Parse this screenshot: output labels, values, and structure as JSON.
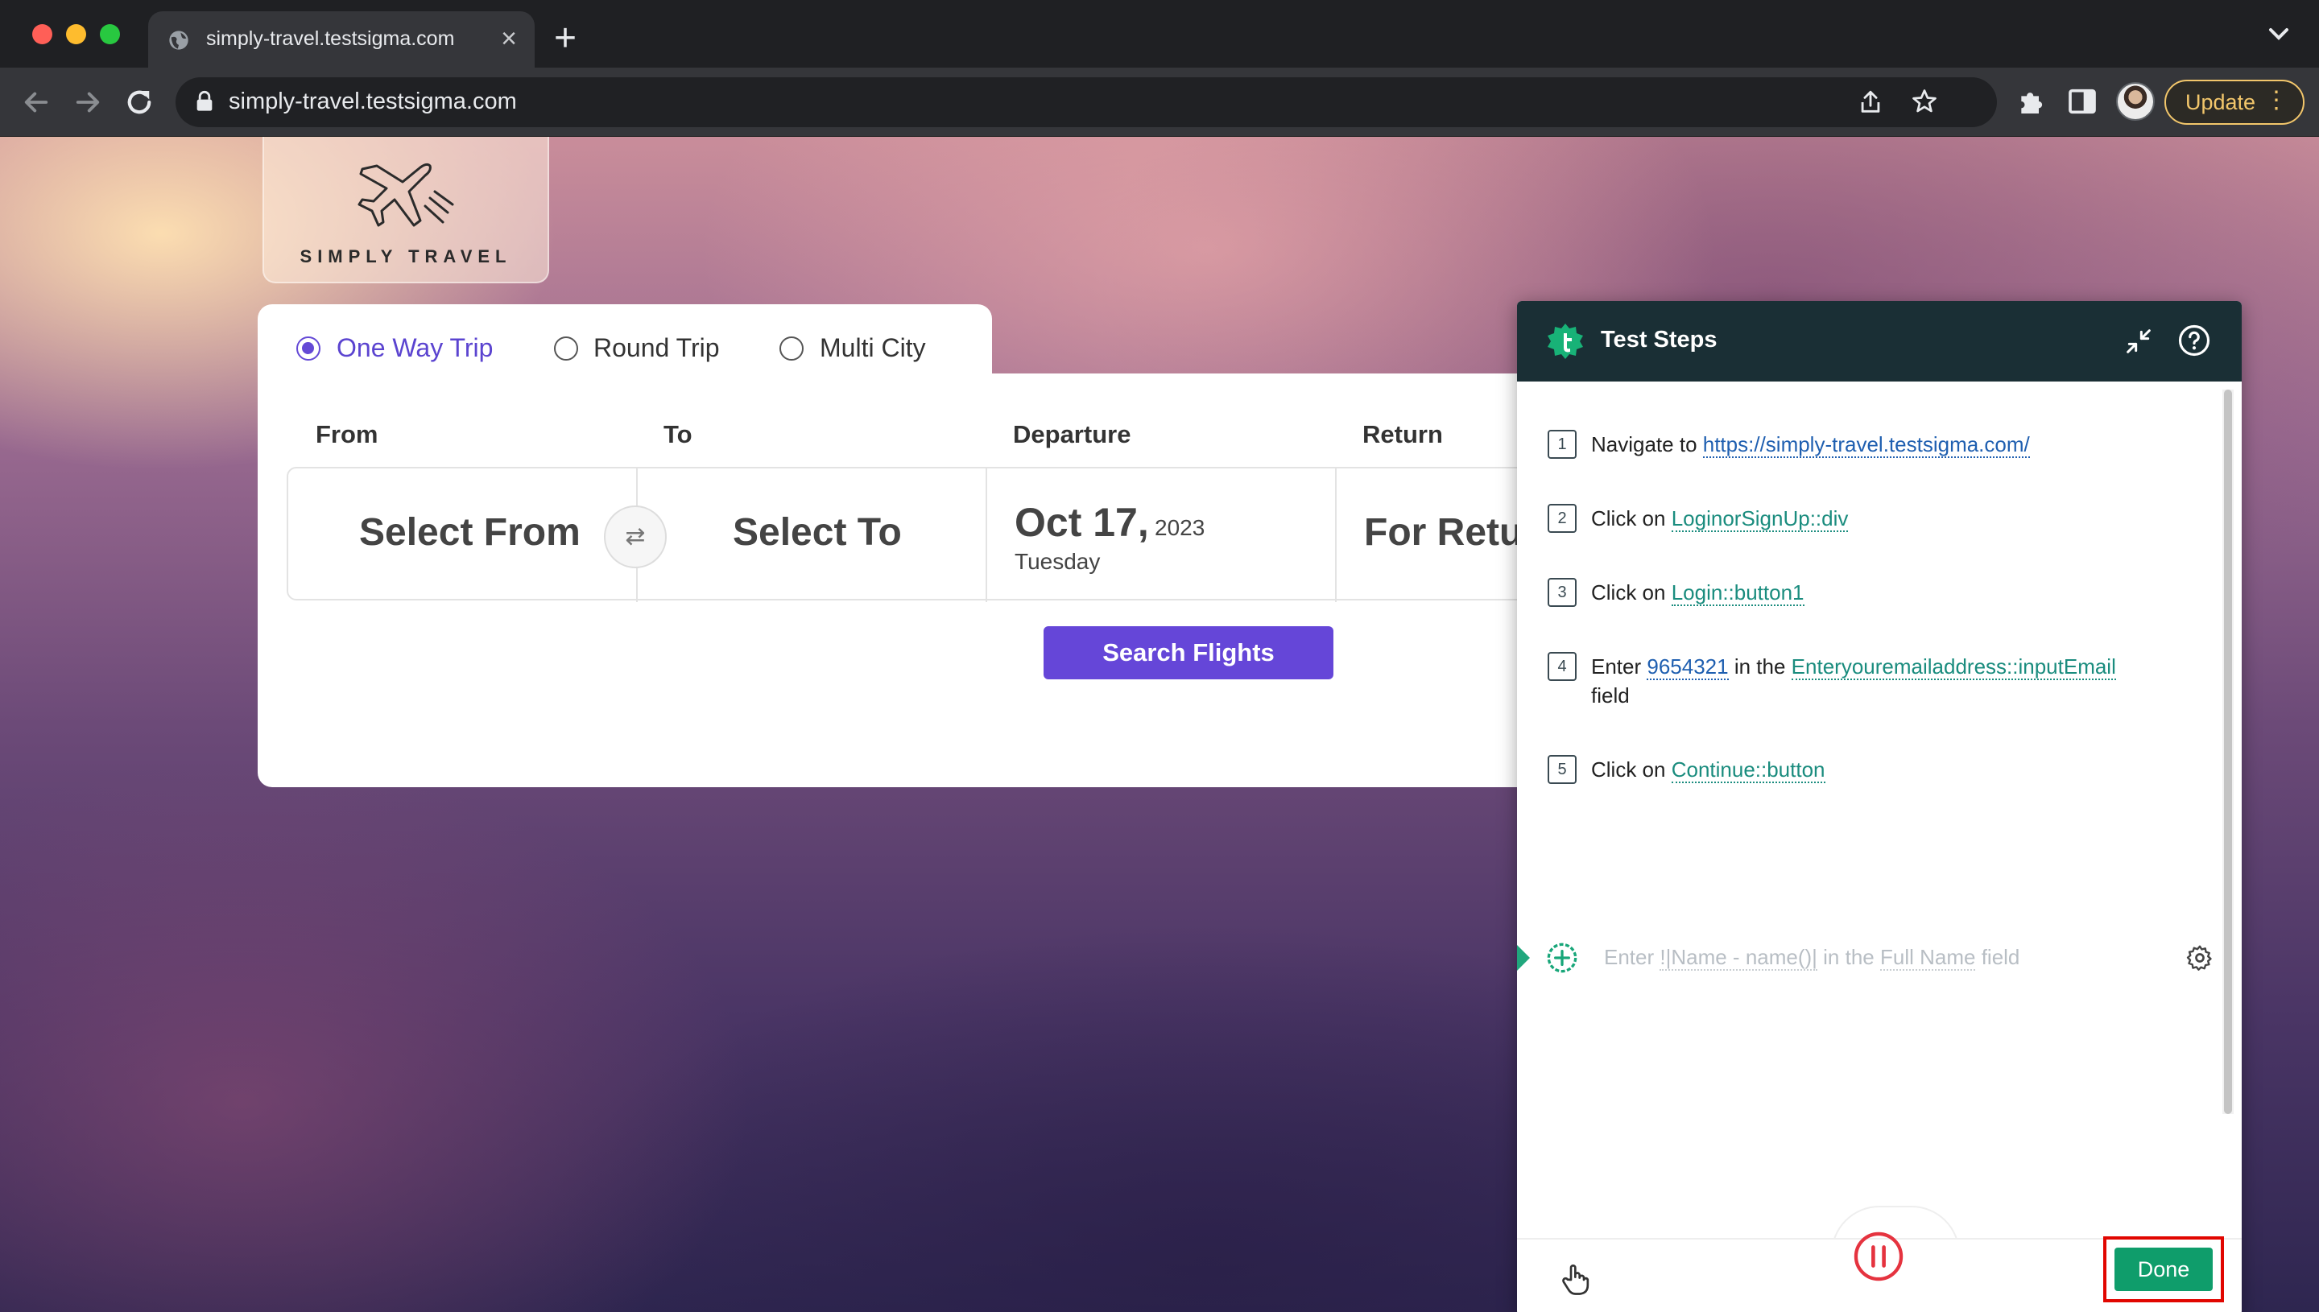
{
  "browser": {
    "tab_title": "simply-travel.testsigma.com",
    "tab_close": "×",
    "new_tab": "+",
    "url": "simply-travel.testsigma.com",
    "update_label": "Update",
    "menu_dots": "⋮",
    "icons": [
      "globe-icon",
      "back-icon",
      "forward-icon",
      "reload-icon",
      "lock-icon",
      "share-icon",
      "star-icon",
      "extensions-icon",
      "sidepanel-icon",
      "chevron-down-icon"
    ]
  },
  "site": {
    "logo_text": "SIMPLY TRAVEL",
    "trip_types": [
      {
        "label": "One Way Trip",
        "selected": true
      },
      {
        "label": "Round Trip",
        "selected": false
      },
      {
        "label": "Multi City",
        "selected": false
      }
    ],
    "labels": {
      "from": "From",
      "to": "To",
      "departure": "Departure",
      "return": "Return"
    },
    "from_value": "Select From",
    "swap": "⇄",
    "to_value": "Select To",
    "departure_date": "Oct 17,",
    "departure_year": "2023",
    "departure_day": "Tuesday",
    "return_value": "For Return",
    "search_button": "Search Flights",
    "accent_color": "#6546d8"
  },
  "testsigma": {
    "title": "Test Steps",
    "steps": [
      {
        "num": "1",
        "pre": "Navigate to ",
        "link": "https://simply-travel.testsigma.com/"
      },
      {
        "num": "2",
        "pre": "Click on ",
        "link": "LoginorSignUp::div"
      },
      {
        "num": "3",
        "pre": "Click on ",
        "link": "Login::button1"
      },
      {
        "num": "4",
        "pre": "Enter ",
        "value": "9654321",
        "mid": " in the ",
        "link": "Enteryouremailaddress::inputEmail",
        "post": " field"
      },
      {
        "num": "5",
        "pre": "Click on ",
        "link": "Continue::button"
      }
    ],
    "new_step": {
      "pre": "Enter ",
      "value": "!|Name - name()|",
      "mid": " in the ",
      "element": "Full Name",
      "post": " field"
    },
    "done_label": "Done",
    "header_color": "#1a2f35",
    "done_color": "#0f9d6b"
  }
}
